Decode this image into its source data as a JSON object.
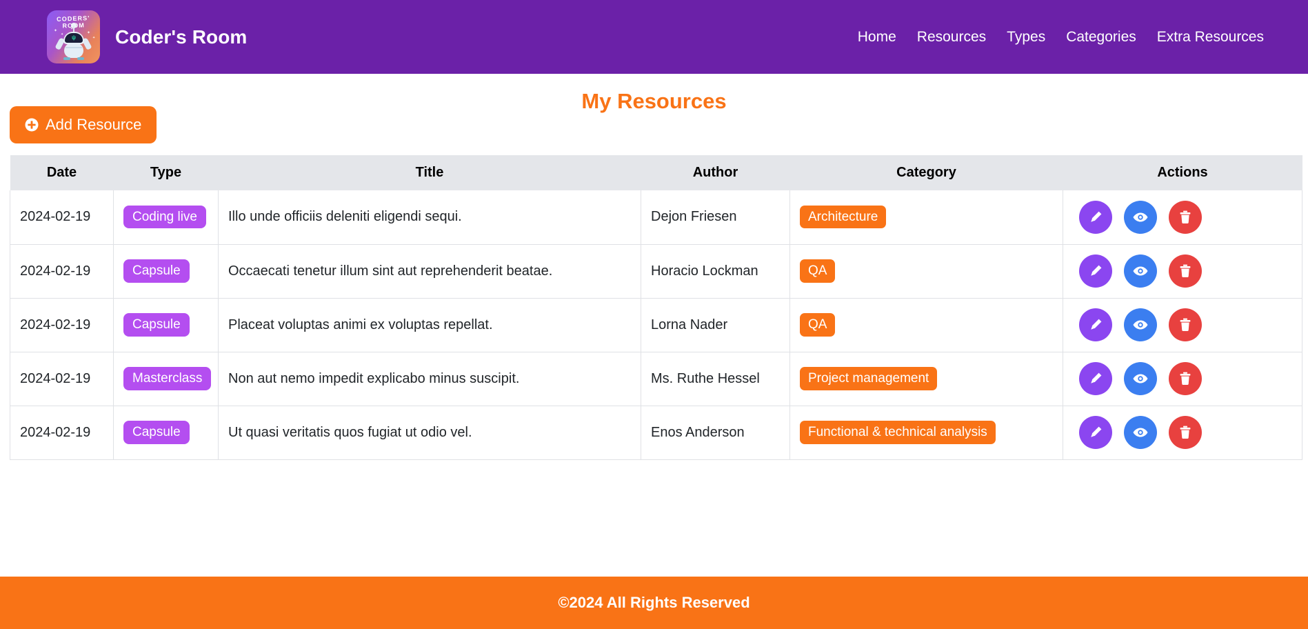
{
  "theme": {
    "header_bg": "#6b21a8",
    "accent_orange": "#f97316",
    "badge_type_purple": "#b44ef0",
    "edit_purple": "#8b46f0",
    "view_blue": "#3b7ef0",
    "delete_red": "#e8413f",
    "table_head_bg": "#e4e6ea"
  },
  "header": {
    "brand_name": "Coder's Room",
    "logo_text": "CODERS' ROOM",
    "logo_icon": "robot-mascot-logo",
    "nav": [
      {
        "label": "Home"
      },
      {
        "label": "Resources"
      },
      {
        "label": "Types"
      },
      {
        "label": "Categories"
      },
      {
        "label": "Extra Resources"
      }
    ]
  },
  "main": {
    "title": "My Resources",
    "add_button": {
      "label": "Add Resource",
      "icon": "plus-circle-icon"
    },
    "table": {
      "columns": [
        "Date",
        "Type",
        "Title",
        "Author",
        "Category",
        "Actions"
      ],
      "row_actions": [
        {
          "name": "edit",
          "icon": "pencil-icon"
        },
        {
          "name": "view",
          "icon": "eye-icon"
        },
        {
          "name": "delete",
          "icon": "trash-icon"
        }
      ],
      "rows": [
        {
          "date": "2024-02-19",
          "type": "Coding live",
          "title": "Illo unde officiis deleniti eligendi sequi.",
          "author": "Dejon Friesen",
          "category": "Architecture"
        },
        {
          "date": "2024-02-19",
          "type": "Capsule",
          "title": "Occaecati tenetur illum sint aut reprehenderit beatae.",
          "author": "Horacio Lockman",
          "category": "QA"
        },
        {
          "date": "2024-02-19",
          "type": "Capsule",
          "title": "Placeat voluptas animi ex voluptas repellat.",
          "author": "Lorna Nader",
          "category": "QA"
        },
        {
          "date": "2024-02-19",
          "type": "Masterclass",
          "title": "Non aut nemo impedit explicabo minus suscipit.",
          "author": "Ms. Ruthe Hessel",
          "category": "Project management"
        },
        {
          "date": "2024-02-19",
          "type": "Capsule",
          "title": "Ut quasi veritatis quos fugiat ut odio vel.",
          "author": "Enos Anderson",
          "category": "Functional & technical analysis"
        }
      ]
    }
  },
  "footer": {
    "copyright": "©2024 All Rights Reserved"
  }
}
